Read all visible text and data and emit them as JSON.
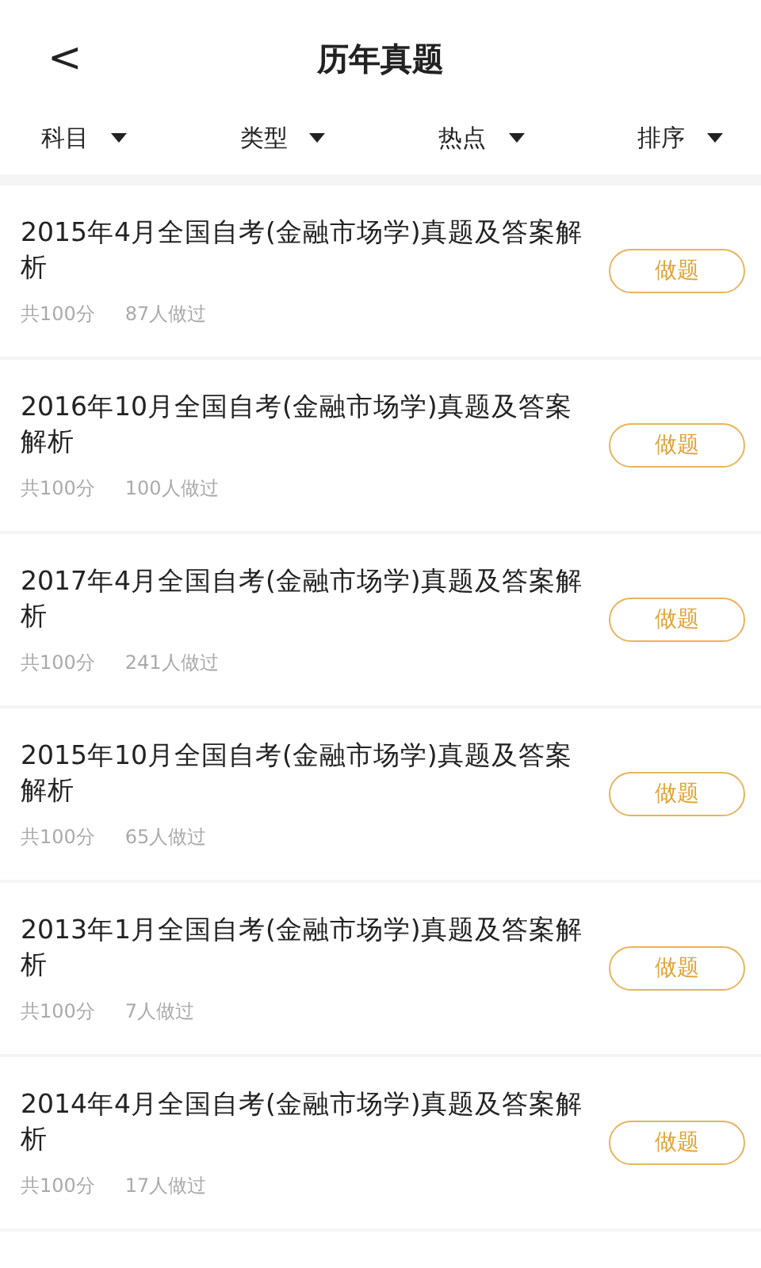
{
  "header": {
    "back": "<",
    "title": "历年真题"
  },
  "filters": [
    {
      "label": "科目"
    },
    {
      "label": "类型"
    },
    {
      "label": "热点"
    },
    {
      "label": "排序"
    }
  ],
  "papers": [
    {
      "title": "2015年4月全国自考(金融市场学)真题及答案解析",
      "score": "共100分",
      "done": "87人做过",
      "action": "做题"
    },
    {
      "title": "2016年10月全国自考(金融市场学)真题及答案解析",
      "score": "共100分",
      "done": "100人做过",
      "action": "做题"
    },
    {
      "title": "2017年4月全国自考(金融市场学)真题及答案解析",
      "score": "共100分",
      "done": "241人做过",
      "action": "做题"
    },
    {
      "title": "2015年10月全国自考(金融市场学)真题及答案解析",
      "score": "共100分",
      "done": "65人做过",
      "action": "做题"
    },
    {
      "title": "2013年1月全国自考(金融市场学)真题及答案解析",
      "score": "共100分",
      "done": "7人做过",
      "action": "做题"
    },
    {
      "title": "2014年4月全国自考(金融市场学)真题及答案解析",
      "score": "共100分",
      "done": "17人做过",
      "action": "做题"
    }
  ]
}
